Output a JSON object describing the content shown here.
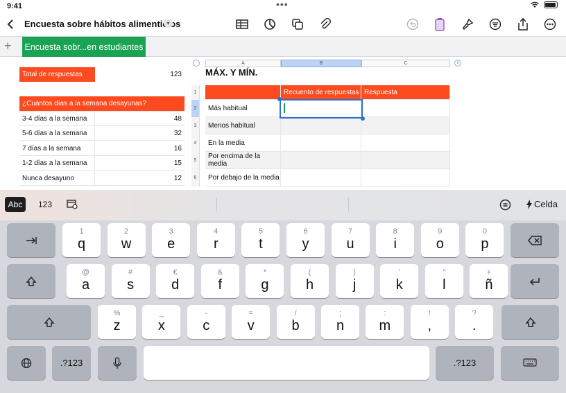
{
  "status": {
    "time": "9:41"
  },
  "toolbar": {
    "title": "Encuesta sobre hábitos alimenticios",
    "icons": [
      "back-chevron-icon",
      "table-icon",
      "chart-icon",
      "shapes-icon",
      "attachment-icon",
      "undo-icon",
      "clipboard-icon",
      "format-brush-icon",
      "organize-icon",
      "share-icon",
      "more-icon"
    ]
  },
  "sheet": {
    "tab_label": "Encuesta sobr...en estudiantes",
    "add_label": "+"
  },
  "left_table": {
    "total": {
      "label": "Total de respuestas",
      "value": "123"
    },
    "header": "¿Cuántos días a la semana desayunas?",
    "rows": [
      {
        "label": "3-4 días a la semana",
        "value": "48"
      },
      {
        "label": "5-6 días a la semana",
        "value": "32"
      },
      {
        "label": "7 días a la semana",
        "value": "16"
      },
      {
        "label": "1-2 días a la semana",
        "value": "15"
      },
      {
        "label": "Nunca desayuno",
        "value": "12"
      }
    ]
  },
  "right_table": {
    "title": "MÁX. Y MÍN.",
    "columns": [
      "A",
      "B",
      "C"
    ],
    "row_numbers": [
      "1",
      "2",
      "3",
      "4",
      "5",
      "6"
    ],
    "header": [
      "",
      "Recuento de respuestas",
      "Respuesta"
    ],
    "rows": [
      "Más habitual",
      "Menos habitual",
      "En la media",
      "Por encima de la media",
      "Por debajo de la media"
    ]
  },
  "keyboard": {
    "suggest": {
      "abc": "Abc",
      "num": "123",
      "cell": "Celda"
    },
    "row1": [
      {
        "k": "q",
        "s": "1"
      },
      {
        "k": "w",
        "s": "2"
      },
      {
        "k": "e",
        "s": "3"
      },
      {
        "k": "r",
        "s": "4"
      },
      {
        "k": "t",
        "s": "5"
      },
      {
        "k": "y",
        "s": "6"
      },
      {
        "k": "u",
        "s": "7"
      },
      {
        "k": "i",
        "s": "8"
      },
      {
        "k": "o",
        "s": "9"
      },
      {
        "k": "p",
        "s": "0"
      }
    ],
    "row2": [
      {
        "k": "a",
        "s": "@"
      },
      {
        "k": "s",
        "s": "#"
      },
      {
        "k": "d",
        "s": "€"
      },
      {
        "k": "f",
        "s": "&"
      },
      {
        "k": "g",
        "s": "*"
      },
      {
        "k": "h",
        "s": "("
      },
      {
        "k": "j",
        "s": ")"
      },
      {
        "k": "k",
        "s": "’"
      },
      {
        "k": "l",
        "s": "”"
      },
      {
        "k": "ñ",
        "s": "+"
      }
    ],
    "row3": [
      {
        "k": "z",
        "s": "%"
      },
      {
        "k": "x",
        "s": "_"
      },
      {
        "k": "c",
        "s": "-"
      },
      {
        "k": "v",
        "s": "="
      },
      {
        "k": "b",
        "s": "/"
      },
      {
        "k": "n",
        "s": ";"
      },
      {
        "k": "m",
        "s": ":"
      },
      {
        "k": ",",
        "s": "!"
      },
      {
        "k": ".",
        "s": "?"
      }
    ],
    "num_label": ".?123"
  }
}
